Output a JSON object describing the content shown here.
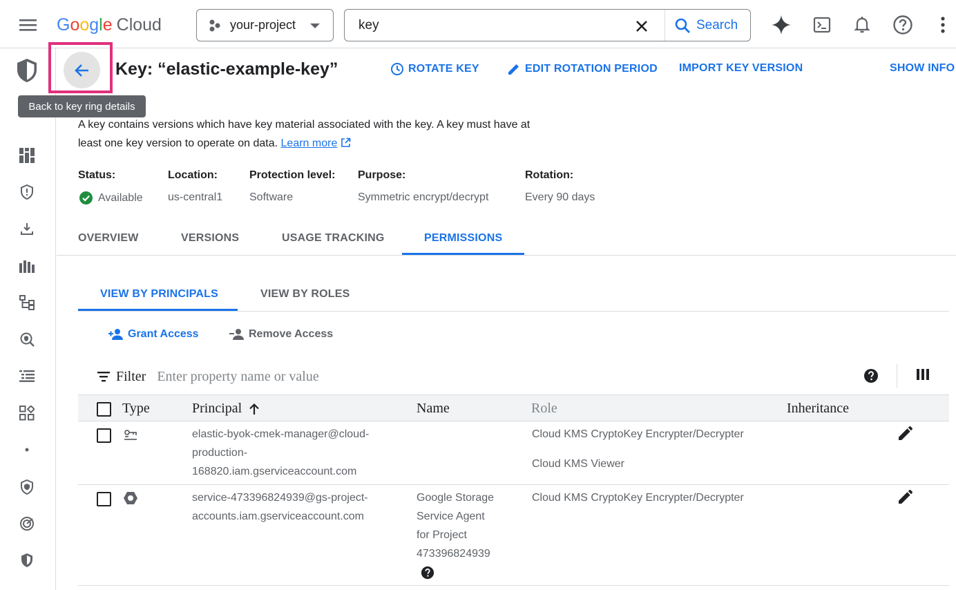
{
  "topbar": {
    "logo": {
      "g1": "G",
      "g2": "o",
      "g3": "o",
      "g4": "g",
      "g5": "l",
      "g6": "e",
      "cloud": "Cloud"
    },
    "project_label": "your-project",
    "search_value": "key",
    "search_button": "Search",
    "icons": [
      "menu-icon",
      "project-icon",
      "chevron-down-icon",
      "close-icon",
      "search-icon",
      "gemini-sparkle-icon",
      "cloud-shell-icon",
      "notifications-icon",
      "help-icon",
      "more-vert-icon"
    ]
  },
  "header": {
    "title": "Key: “elastic-example-key”",
    "back_tooltip": "Back to key ring details",
    "actions": {
      "rotate": "ROTATE KEY",
      "edit_rotation": "EDIT ROTATION PERIOD",
      "import": "IMPORT KEY VERSION",
      "show_info": "SHOW INFO"
    },
    "highlight_color": "#e0307d"
  },
  "description": {
    "text": "A key contains versions which have key material associated with the key. A key must have at least one key version to operate on data.",
    "link": "Learn more"
  },
  "details": {
    "status": {
      "label": "Status:",
      "value": "Available"
    },
    "location": {
      "label": "Location:",
      "value": "us-central1"
    },
    "protection": {
      "label": "Protection level:",
      "value": "Software"
    },
    "purpose": {
      "label": "Purpose:",
      "value": "Symmetric encrypt/decrypt"
    },
    "rotation": {
      "label": "Rotation:",
      "value": "Every 90 days"
    }
  },
  "tabs": [
    "OVERVIEW",
    "VERSIONS",
    "USAGE TRACKING",
    "PERMISSIONS"
  ],
  "active_tab": "PERMISSIONS",
  "subtabs": [
    "VIEW BY PRINCIPALS",
    "VIEW BY ROLES"
  ],
  "active_subtab": "VIEW BY PRINCIPALS",
  "access": {
    "grant": "Grant Access",
    "remove": "Remove Access"
  },
  "filter": {
    "label": "Filter",
    "placeholder": "Enter property name or value"
  },
  "table": {
    "columns": {
      "type": "Type",
      "principal": "Principal",
      "name": "Name",
      "role": "Role",
      "inheritance": "Inheritance"
    },
    "rows": [
      {
        "type_icon": "service-account-icon",
        "principal": "elastic-byok-cmek-manager@cloud-production-168820.iam.gserviceaccount.com",
        "principal_lines": [
          "elastic-byok-cmek-manager@cloud-",
          "production-",
          "168820.iam.gserviceaccount.com"
        ],
        "name": "",
        "roles": [
          "Cloud KMS CryptoKey Encrypter/Decrypter",
          "Cloud KMS Viewer"
        ],
        "inheritance": ""
      },
      {
        "type_icon": "google-service-agent-icon",
        "principal": "service-473396824939@gs-project-accounts.iam.gserviceaccount.com",
        "principal_lines": [
          "service-473396824939@gs-project-",
          "accounts.iam.gserviceaccount.com"
        ],
        "name": "Google Storage Service Agent for Project 473396824939",
        "name_lines": [
          "Google Storage",
          "Service Agent",
          "for Project",
          "473396824939"
        ],
        "roles": [
          "Cloud KMS CryptoKey Encrypter/Decrypter"
        ],
        "inheritance": ""
      }
    ]
  },
  "colors": {
    "accent": "#1a73e8",
    "status_ok": "#1e8e3e",
    "text": "#202124",
    "muted": "#5f6368"
  }
}
